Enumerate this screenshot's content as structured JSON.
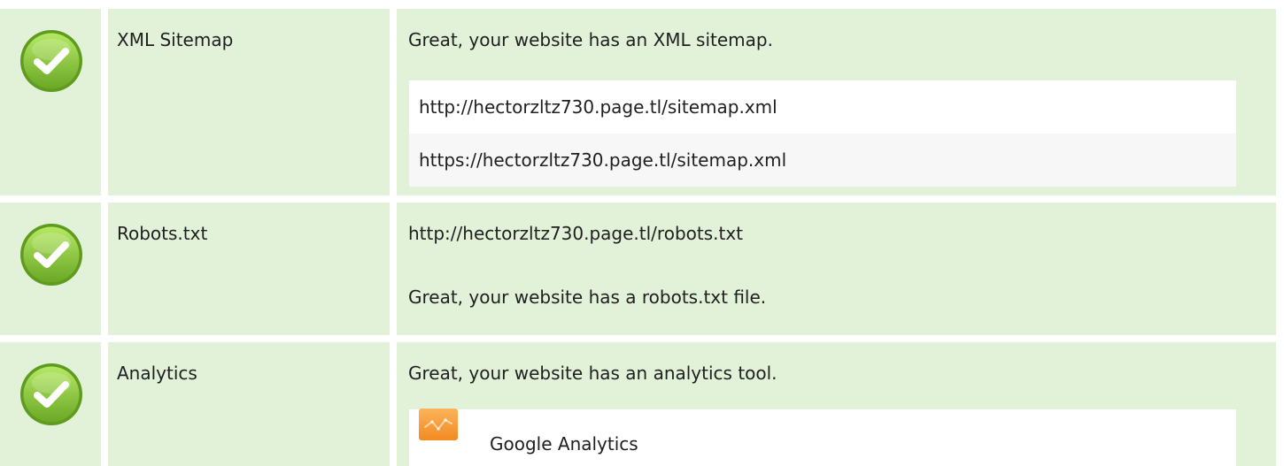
{
  "checks": [
    {
      "icon": "check-icon",
      "status": "pass",
      "label": "XML Sitemap",
      "message": "Great, your website has an XML sitemap.",
      "urls": [
        "http://hectorzltz730.page.tl/sitemap.xml",
        "https://hectorzltz730.page.tl/sitemap.xml"
      ]
    },
    {
      "icon": "check-icon",
      "status": "pass",
      "label": "Robots.txt",
      "url": "http://hectorzltz730.page.tl/robots.txt",
      "message": "Great, your website has a robots.txt file."
    },
    {
      "icon": "check-icon",
      "status": "pass",
      "label": "Analytics",
      "message": "Great, your website has an analytics tool.",
      "tools": [
        {
          "icon": "google-analytics-logo-icon",
          "name": "Google Analytics"
        }
      ]
    }
  ],
  "colors": {
    "row_background": "#e1f2d9",
    "check_green_light": "#a6dd52",
    "check_green_dark": "#5e9b1e",
    "list_odd": "#ffffff",
    "list_even": "#f7f7f7",
    "analytics_orange": "#f59a36"
  }
}
